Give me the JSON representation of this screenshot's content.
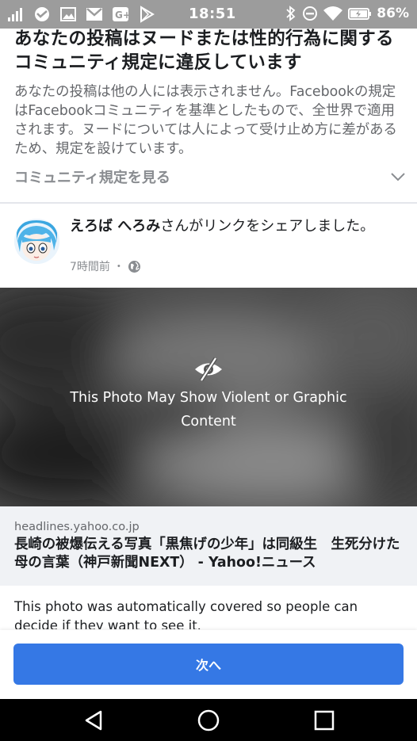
{
  "status_bar": {
    "time": "18:51",
    "battery": "86%",
    "icons_left": [
      "signal-icon",
      "app-icon",
      "image-icon",
      "gmail-icon",
      "google-plus-icon",
      "play-store-icon"
    ],
    "icons_right": [
      "bluetooth-icon",
      "do-not-disturb-icon",
      "wifi-icon",
      "battery-icon"
    ]
  },
  "violation": {
    "title": "あなたの投稿はヌードまたは性的行為に関するコミュニティ規定に違反しています",
    "description": "あなたの投稿は他の人には表示されません。Facebookの規定はFacebookコミュニティを基準としたもので、全世界で適用されます。ヌードについては人によって受け止め方に差があるため、規定を設けています。",
    "policy_link": "コミュニティ規定を見る"
  },
  "post": {
    "author": "えろば へろみ",
    "action": "さんがリンクをシェアしました。",
    "time": "7時間前",
    "separator": "・"
  },
  "photo": {
    "warning": "This Photo May Show Violent or Graphic Content"
  },
  "link": {
    "domain": "headlines.yahoo.co.jp",
    "title": "長崎の被爆伝える写真「黒焦げの少年」は同級生　生死分けた母の言葉（神戸新聞NEXT） - Yahoo!ニュース"
  },
  "note": {
    "text": "This photo was automatically covered so people can decide if they want to see it."
  },
  "footer": {
    "next_label": "次へ"
  },
  "colors": {
    "accent": "#3578e5",
    "status_bar": "#9c9c9c",
    "text_primary": "#1c1e21",
    "text_secondary": "#65676b"
  }
}
